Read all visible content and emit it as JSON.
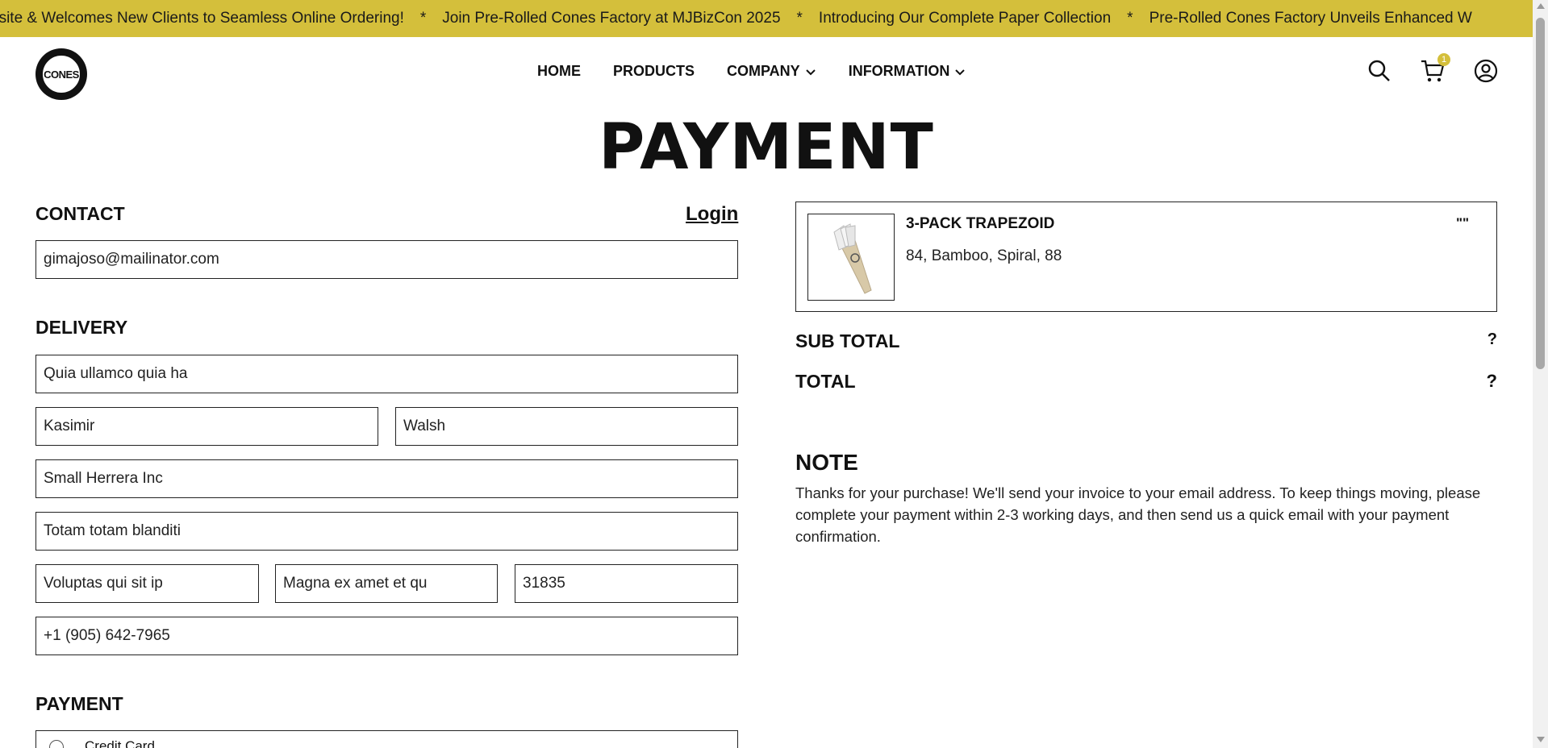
{
  "marquee": {
    "items": [
      "osite & Welcomes New Clients to Seamless Online Ordering!",
      "Join Pre-Rolled Cones Factory at MJBizCon 2025",
      "Introducing Our Complete Paper Collection",
      "Pre-Rolled Cones Factory Unveils Enhanced W"
    ],
    "separator": "*",
    "bg_color": "#d4bf3b"
  },
  "header": {
    "logo_text": "CONES",
    "nav": [
      {
        "label": "HOME",
        "has_dropdown": false
      },
      {
        "label": "PRODUCTS",
        "has_dropdown": false
      },
      {
        "label": "COMPANY",
        "has_dropdown": true
      },
      {
        "label": "INFORMATION",
        "has_dropdown": true
      }
    ],
    "cart_count": "1",
    "icons": [
      "search-icon",
      "cart-icon",
      "account-icon"
    ]
  },
  "page": {
    "title": "PAYMENT"
  },
  "contact": {
    "title": "CONTACT",
    "login_label": "Login",
    "email": "gimajoso@mailinator.com"
  },
  "delivery": {
    "title": "DELIVERY",
    "country": "Quia ullamco quia ha",
    "first_name": "Kasimir",
    "last_name": "Walsh",
    "company": "Small Herrera Inc",
    "address": "Totam totam blanditi",
    "city": "Voluptas qui sit ip",
    "state": "Magna ex amet et qu",
    "zip": "31835",
    "phone": "+1 (905) 642-7965"
  },
  "payment": {
    "title": "PAYMENT",
    "option_label": "Credit Card"
  },
  "order": {
    "product_name": "3-PACK TRAPEZOID",
    "product_variant": "84, Bamboo, Spiral, 88",
    "product_qty": "\"\"",
    "subtotal_label": "SUB TOTAL",
    "subtotal_value": "?",
    "total_label": "TOTAL",
    "total_value": "?"
  },
  "note": {
    "title": "NOTE",
    "text": "Thanks for your purchase! We'll send your invoice to your email address. To keep things moving, please complete your payment within 2-3 working days, and then send us a quick email with your payment confirmation."
  }
}
